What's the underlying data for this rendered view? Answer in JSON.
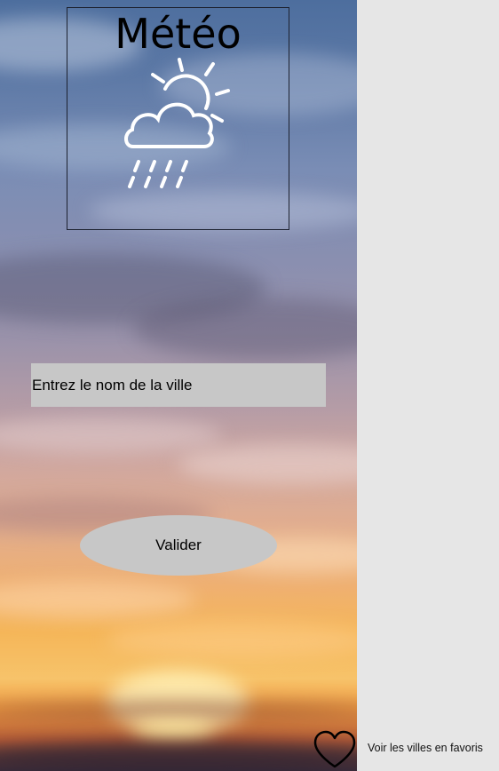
{
  "header": {
    "title": "Météo",
    "logo_icon": "sun-cloud-rain-icon"
  },
  "search": {
    "placeholder": "Entrez le nom de la ville",
    "value": ""
  },
  "actions": {
    "validate_label": "Valider"
  },
  "favorites": {
    "icon": "heart-icon",
    "label": "Voir les villes en favoris"
  },
  "colors": {
    "panel_gray": "#c7c7c7",
    "page_background": "#e6e6e6",
    "text": "#000000"
  }
}
